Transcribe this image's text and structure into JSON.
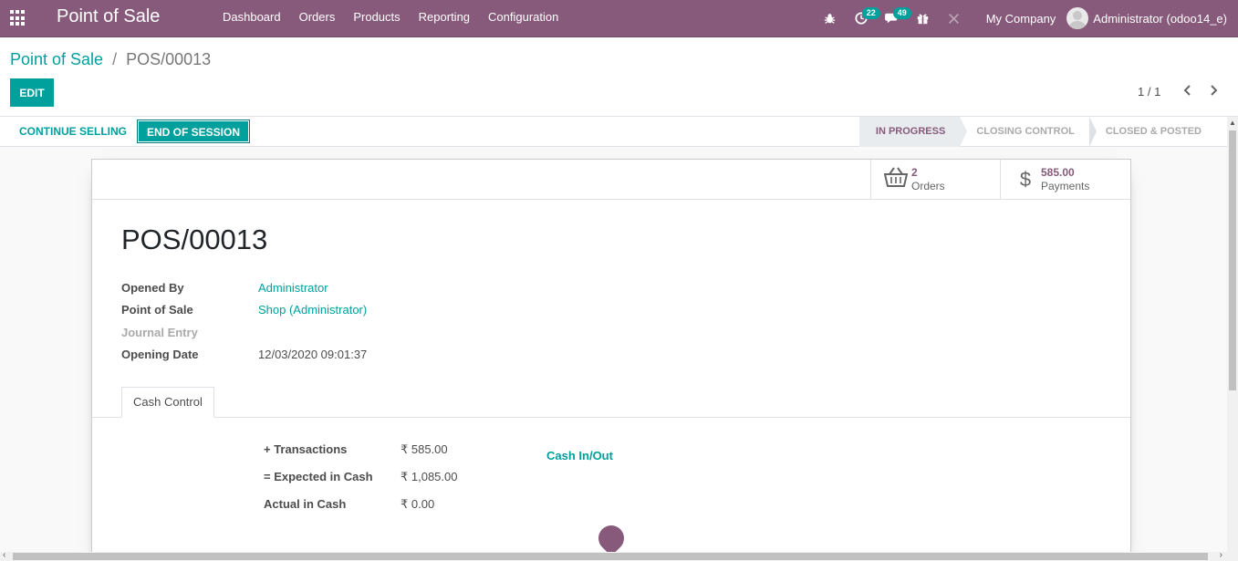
{
  "navbar": {
    "brand": "Point of Sale",
    "menu": [
      "Dashboard",
      "Orders",
      "Products",
      "Reporting",
      "Configuration"
    ],
    "activity_count": "22",
    "messages_count": "49",
    "company": "My Company",
    "user": "Administrator (odoo14_e)"
  },
  "breadcrumb": {
    "parent": "Point of Sale",
    "separator": "/",
    "current": "POS/00013"
  },
  "control": {
    "edit_label": "EDIT",
    "pager": "1 / 1"
  },
  "statusbar": {
    "continue_label": "CONTINUE SELLING",
    "end_label": "END OF SESSION",
    "stages": [
      "IN PROGRESS",
      "CLOSING CONTROL",
      "CLOSED & POSTED"
    ],
    "active_stage": "IN PROGRESS"
  },
  "buttons": {
    "orders_value": "2",
    "orders_label": "Orders",
    "payments_value": "585.00",
    "payments_label": "Payments"
  },
  "form": {
    "title": "POS/00013",
    "fields": [
      {
        "label": "Opened By",
        "value": "Administrator"
      },
      {
        "label": "Point of Sale",
        "value": "Shop (Administrator)"
      },
      {
        "label": "Journal Entry",
        "value": ""
      },
      {
        "label": "Opening Date",
        "value": "12/03/2020 09:01:37"
      }
    ]
  },
  "tabs": [
    "Cash Control"
  ],
  "cash": {
    "rows": [
      {
        "label": "+ Transactions",
        "value": "₹ 585.00"
      },
      {
        "label": "= Expected in Cash",
        "value": "₹ 1,085.00"
      },
      {
        "label": "Actual in Cash",
        "value": "₹ 0.00"
      }
    ],
    "cash_inout_label": "Cash In/Out"
  },
  "colors": {
    "navbar": "#875a7b",
    "accent": "#00a09d"
  }
}
